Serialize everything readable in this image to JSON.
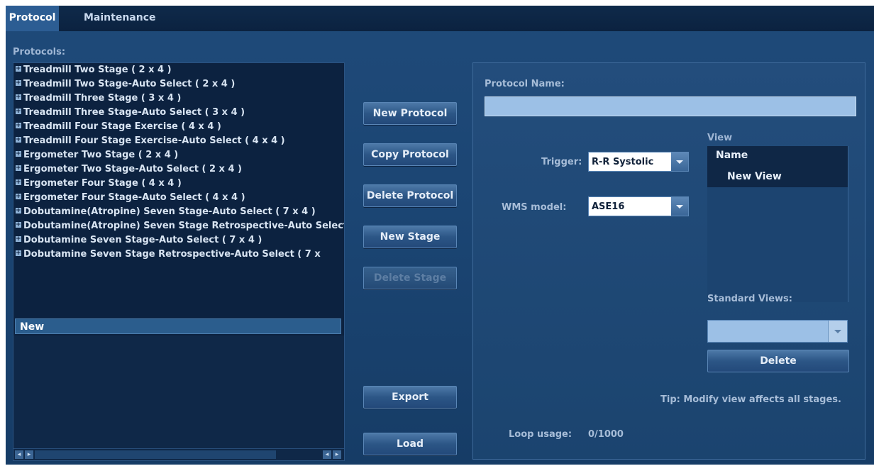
{
  "tabs": {
    "protocol": "Protocol",
    "maintenance": "Maintenance"
  },
  "protocols_label": "Protocols:",
  "protocols": [
    "Treadmill Two Stage ( 2 x 4 )",
    "Treadmill Two Stage-Auto Select ( 2 x 4 )",
    "Treadmill Three Stage ( 3 x 4 )",
    "Treadmill Three Stage-Auto Select ( 3 x 4 )",
    "Treadmill Four Stage Exercise ( 4 x 4 )",
    "Treadmill Four Stage Exercise-Auto Select ( 4 x 4 )",
    "Ergometer Two Stage ( 2 x 4 )",
    "Ergometer Two Stage-Auto Select ( 2 x 4 )",
    "Ergometer Four Stage ( 4 x 4 )",
    "Ergometer Four Stage-Auto Select ( 4 x 4 )",
    "Dobutamine(Atropine) Seven Stage-Auto Select ( 7 x 4 )",
    "Dobutamine(Atropine) Seven Stage Retrospective-Auto Select",
    "Dobutamine Seven Stage-Auto Select ( 7 x 4 )",
    "Dobutamine Seven Stage Retrospective-Auto Select ( 7 x"
  ],
  "selected_protocol": "New",
  "buttons": {
    "new_protocol": "New Protocol",
    "copy_protocol": "Copy Protocol",
    "delete_protocol": "Delete Protocol",
    "new_stage": "New Stage",
    "delete_stage": "Delete Stage",
    "export": "Export",
    "load": "Load"
  },
  "panel": {
    "protocol_name_label": "Protocol Name:",
    "protocol_name_value": "",
    "trigger_label": "Trigger:",
    "trigger_value": "R-R Systolic",
    "wms_label": "WMS model:",
    "wms_value": "ASE16",
    "view_label": "View",
    "view_header": "Name",
    "view_item": "New View",
    "standard_views_label": "Standard Views:",
    "standard_views_value": "",
    "delete_label": "Delete",
    "tip": "Tip: Modify view affects all stages.",
    "loop_usage_label": "Loop usage:",
    "loop_usage_value": "0/1000"
  },
  "colors": {
    "background": "#1b4573",
    "list_bg": "#0c2240",
    "accent": "#9cc0e6"
  }
}
